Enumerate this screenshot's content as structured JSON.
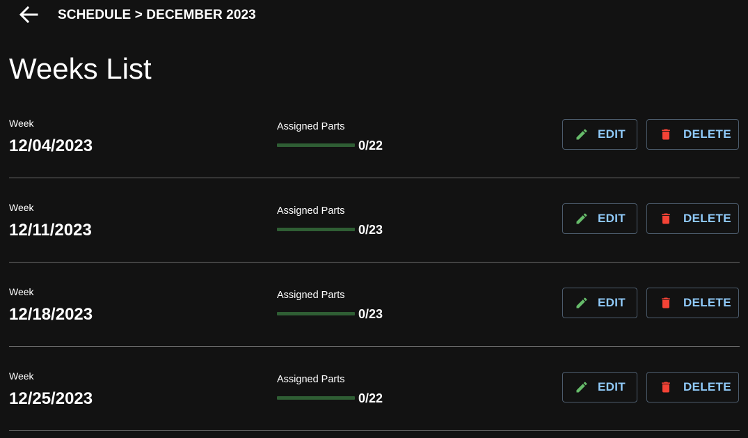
{
  "header": {
    "breadcrumb": "SCHEDULE > DECEMBER 2023",
    "back_icon": "arrow-left-icon"
  },
  "page": {
    "title": "Weeks List"
  },
  "colors": {
    "background": "#121212",
    "accent_text": "#90caf9",
    "edit_icon": "#66bb6a",
    "delete_icon": "#f44336",
    "progress_track": "#2f5e34"
  },
  "weeks": [
    {
      "week_label": "Week",
      "date": "12/04/2023",
      "parts_label": "Assigned Parts",
      "parts_count": "0/22",
      "progress": 0,
      "edit_label": "EDIT",
      "delete_label": "DELETE"
    },
    {
      "week_label": "Week",
      "date": "12/11/2023",
      "parts_label": "Assigned Parts",
      "parts_count": "0/23",
      "progress": 0,
      "edit_label": "EDIT",
      "delete_label": "DELETE"
    },
    {
      "week_label": "Week",
      "date": "12/18/2023",
      "parts_label": "Assigned Parts",
      "parts_count": "0/23",
      "progress": 0,
      "edit_label": "EDIT",
      "delete_label": "DELETE"
    },
    {
      "week_label": "Week",
      "date": "12/25/2023",
      "parts_label": "Assigned Parts",
      "parts_count": "0/22",
      "progress": 0,
      "edit_label": "EDIT",
      "delete_label": "DELETE"
    }
  ]
}
